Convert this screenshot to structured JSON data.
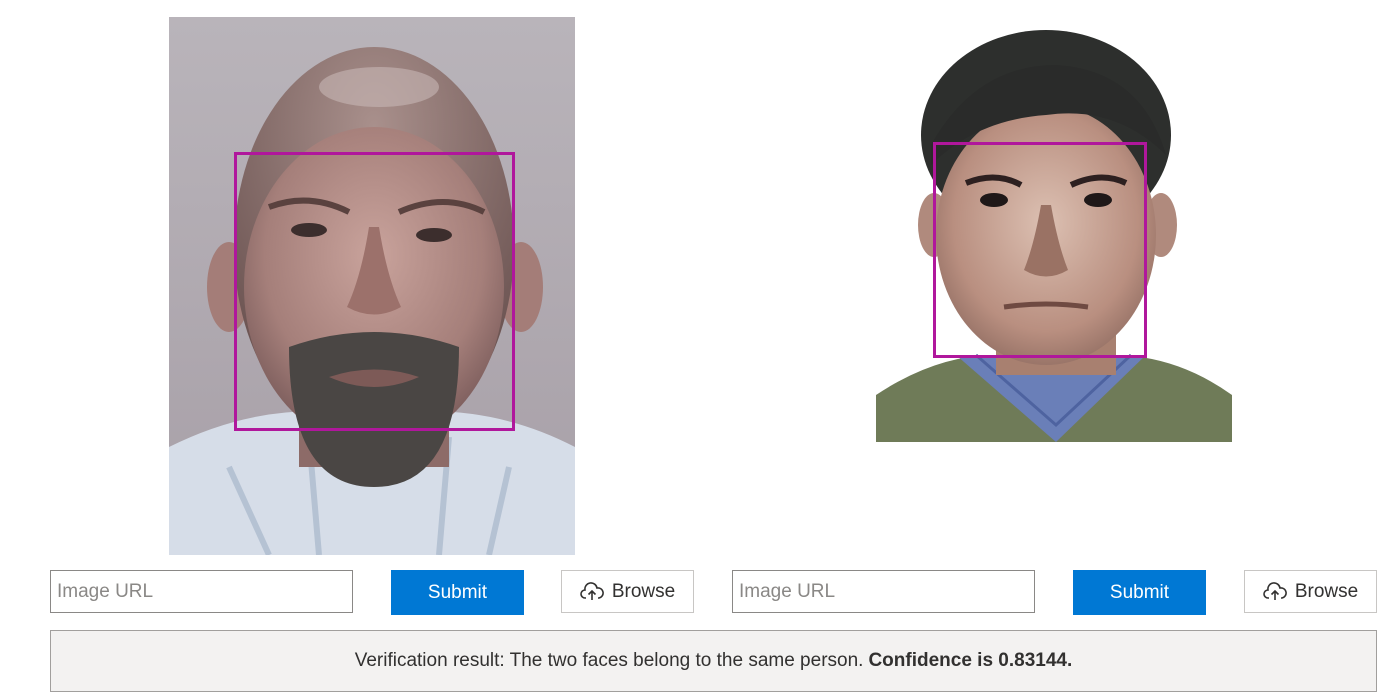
{
  "left_panel": {
    "url_placeholder": "Image URL",
    "submit_label": "Submit",
    "browse_label": "Browse",
    "browse_icon": "cloud-upload-icon"
  },
  "right_panel": {
    "url_placeholder": "Image URL",
    "submit_label": "Submit",
    "browse_label": "Browse",
    "browse_icon": "cloud-upload-icon"
  },
  "result": {
    "text": "Verification result: The two faces belong to the same person.",
    "confidence_text": "Confidence is 0.83144."
  },
  "colors": {
    "face_box": "#b0179c",
    "submit_bg": "#0078d4",
    "result_bg": "#f3f2f1"
  }
}
